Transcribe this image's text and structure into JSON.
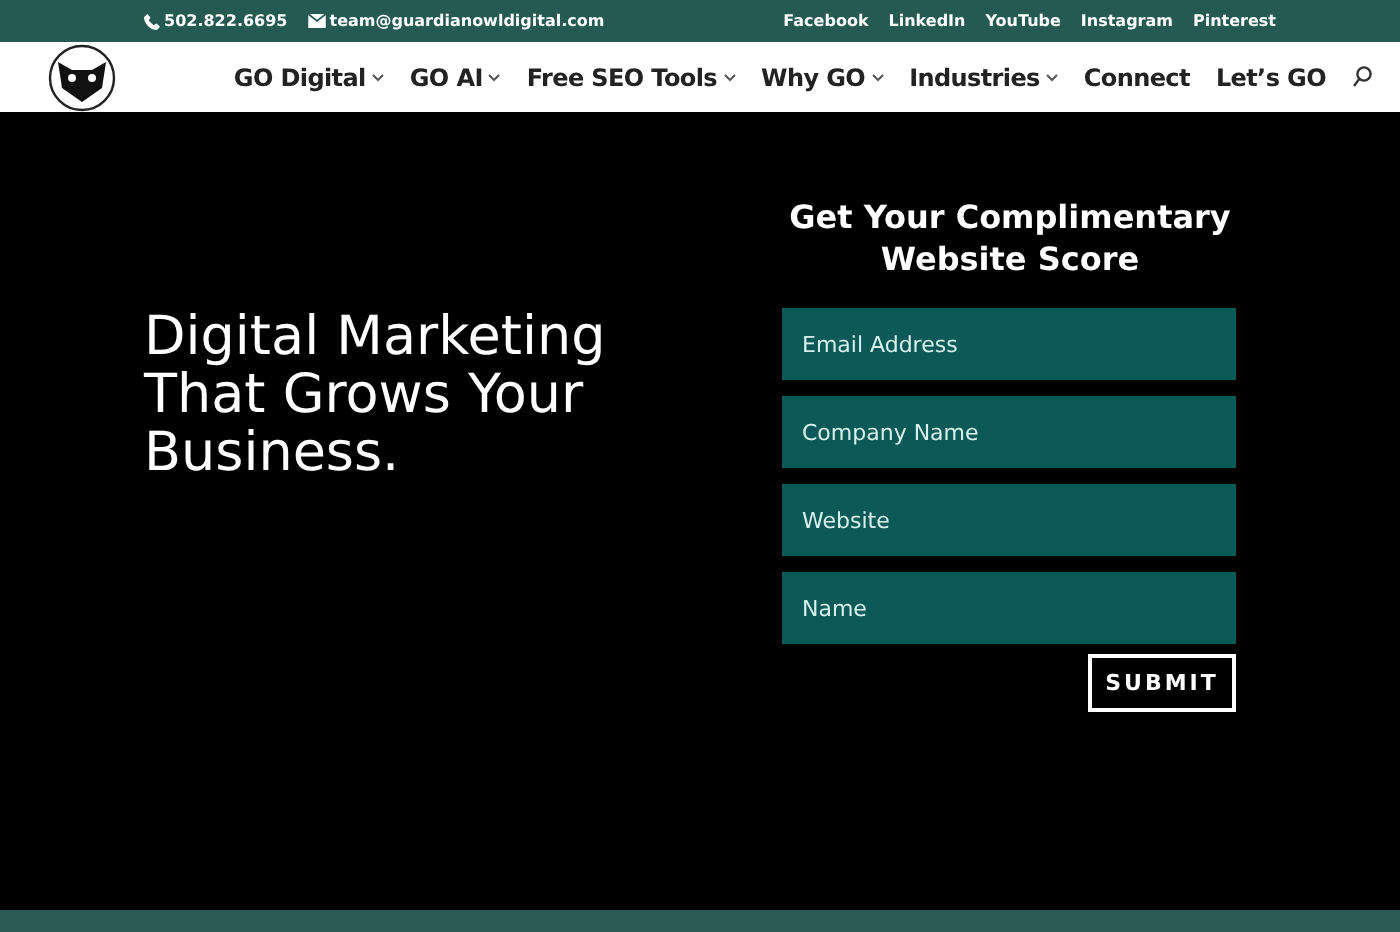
{
  "top_bar": {
    "phone": "502.822.6695",
    "email": "team@guardianowldigital.com",
    "social_links": [
      "Facebook",
      "LinkedIn",
      "YouTube",
      "Instagram",
      "Pinterest"
    ]
  },
  "nav": {
    "items": [
      {
        "label": "GO Digital",
        "has_dropdown": true
      },
      {
        "label": "GO AI",
        "has_dropdown": true
      },
      {
        "label": "Free SEO Tools",
        "has_dropdown": true
      },
      {
        "label": "Why GO",
        "has_dropdown": true
      },
      {
        "label": "Industries",
        "has_dropdown": true
      },
      {
        "label": "Connect",
        "has_dropdown": false
      },
      {
        "label": "Let’s GO",
        "has_dropdown": false
      }
    ]
  },
  "hero": {
    "headline": "Digital Marketing That Grows Your Business."
  },
  "form": {
    "title": "Get Your Complimentary Website Score",
    "fields": [
      {
        "placeholder": "Email Address"
      },
      {
        "placeholder": "Company Name"
      },
      {
        "placeholder": "Website"
      },
      {
        "placeholder": "Name"
      }
    ],
    "submit": "SUBMIT"
  }
}
